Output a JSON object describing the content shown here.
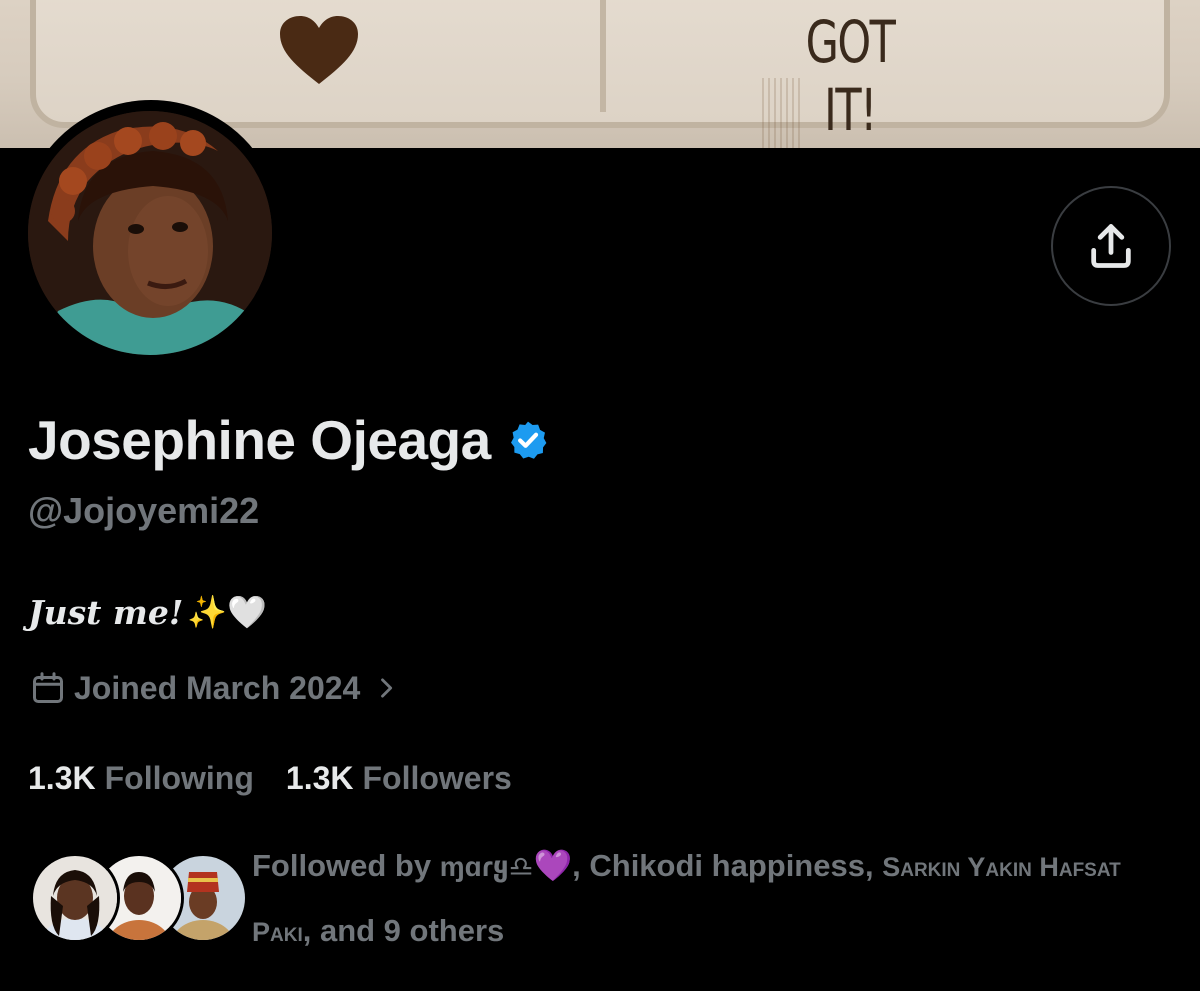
{
  "banner": {
    "text": "GOT IT!"
  },
  "profile": {
    "display_name": "Josephine Ojeaga",
    "handle": "@Jojoyemi22",
    "bio_text": "Just me!",
    "bio_emoji": "✨🤍",
    "joined": "Joined March 2024",
    "following_count": "1.3K",
    "following_label": "Following",
    "followers_count": "1.3K",
    "followers_label": "Followers"
  },
  "followed_by": {
    "prefix": "Followed by",
    "name_1": "ɱɑɾყ♎︎",
    "name_1_emoji": "💜",
    "sep_1": ", ",
    "name_2": "Chikodi happiness",
    "sep_2": ", ",
    "name_3": "Sarkin Yakin Hafsat Paki",
    "suffix": ", and 9 others"
  },
  "icons": {
    "verified": "verified-badge-icon",
    "share": "share-upload-icon",
    "calendar": "calendar-icon",
    "chevron": "chevron-right-icon",
    "banner_heart": "heart-icon"
  },
  "colors": {
    "background": "#000000",
    "primary_text": "#e7e9ea",
    "secondary_text": "#71767b",
    "verified_blue": "#1d9bf0",
    "border": "#3a3d41"
  }
}
